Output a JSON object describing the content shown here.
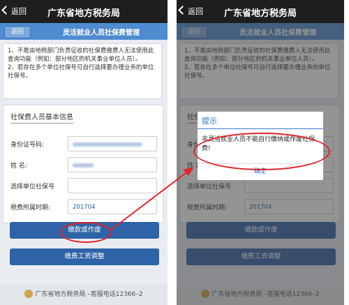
{
  "app": {
    "back_label": "返回",
    "title": "广东省地方税务局"
  },
  "subheader": {
    "back_button": "返回",
    "title": "灵活就业人员社保费管理"
  },
  "notice": {
    "line1": "1、不是由地税部门负责征收的社保费缴费人无法使用此查询功能（例如：部分地区的机关事业单位人员）。",
    "line2": "2、若存在多个单位社保号可自行选择要办理业务的单位社保号。"
  },
  "form": {
    "heading": "社保费人员基本信息",
    "fields": [
      {
        "label": "身份证号码:",
        "value": ""
      },
      {
        "label": "姓 名:",
        "value": ""
      },
      {
        "label": "选择单位社保号",
        "value": ""
      },
      {
        "label": "税费所属时期:",
        "value": "201704"
      }
    ]
  },
  "buttons": {
    "pay_or_void": "缴款或作废",
    "wage_adjust": "缴费工资调整"
  },
  "footer": {
    "text": "广东省地方税务局 –客服电话12366–2"
  },
  "dialog": {
    "title": "提示",
    "message": "非灵活就业人员不能自行缴纳或作废社保费!",
    "ok": "确定"
  },
  "colors": {
    "titlebar": "#1e1e1e",
    "subbar": "#4e8bd0",
    "button": "#2f63a7",
    "annotation": "#e0252a"
  }
}
